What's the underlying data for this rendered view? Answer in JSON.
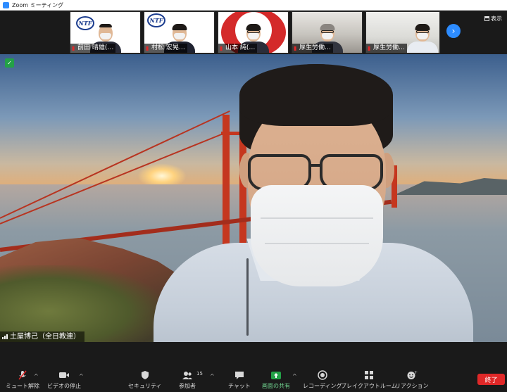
{
  "window": {
    "title": "Zoom ミーティング"
  },
  "view_button": {
    "label": "表示"
  },
  "thumbnails": [
    {
      "name": "前田 晴雄(…",
      "bg": "#ffffff",
      "logo": "NTF"
    },
    {
      "name": "村松 宏晃…",
      "bg": "#ffffff",
      "logo": "NTF"
    },
    {
      "name": "山本 純(…",
      "bg": "#ffffff",
      "logo": ""
    },
    {
      "name": "厚生労働…",
      "bg": "#c9ccd0",
      "logo": ""
    },
    {
      "name": "厚生労働…",
      "bg": "#d4d6d9",
      "logo": ""
    }
  ],
  "main_video": {
    "speaker_name": "土屋博己（全日教連）"
  },
  "toolbar": {
    "mute": "ミュート解除",
    "video": "ビデオの停止",
    "security": "セキュリティ",
    "participants": "参加者",
    "participants_count": "15",
    "chat": "チャット",
    "share": "画面の共有",
    "record": "レコーディング",
    "breakout": "ブレイクアウトルーム",
    "reactions": "リアクション",
    "end": "終了"
  },
  "colors": {
    "accent": "#2d8cff",
    "share_green": "#23a147",
    "end_red": "#e02828"
  }
}
